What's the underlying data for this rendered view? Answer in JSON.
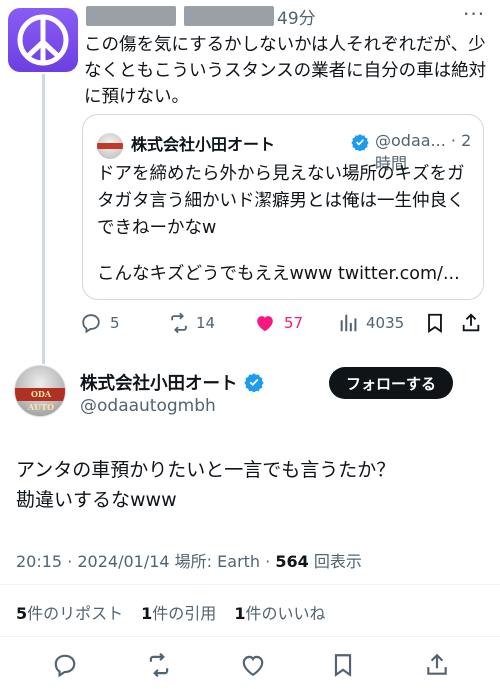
{
  "parent": {
    "time": "49分",
    "more_icon": "more-dots-icon",
    "text": "この傷を気にするかしないかは人それぞれだが、少なくともこういうスタンスの業者に自分の車は絶対に預けない。",
    "quote": {
      "name": "株式会社小田オート",
      "handle_time": "@odaa... · 2時間",
      "text": "ドアを締めたら外から見えない場所のキズをガタガタ言う細かいド潔癖男とは俺は一生仲良くできねーかなw",
      "link_text": "こんなキズどうでもええwww twitter.com/..."
    },
    "actions": {
      "replies": "5",
      "retweets": "14",
      "likes": "57",
      "views": "4035"
    }
  },
  "tweet": {
    "avatar_logo": "ODA AUTO",
    "name": "株式会社小田オート",
    "handle": "@odaautogmbh",
    "follow_label": "フォローする",
    "text_line1": "アンタの車預かりたいと一言でも言うたか？",
    "text_line2": "勘違いするなwww",
    "meta_prefix": "20:15 · 2024/01/14 場所: Earth · ",
    "views": "564",
    "views_suffix": " 回表示",
    "stats": {
      "reposts_count": "5",
      "reposts_label": "件のリポスト",
      "quotes_count": "1",
      "quotes_label": "件の引用",
      "likes_count": "1",
      "likes_label": "件のいいね"
    }
  },
  "colors": {
    "text": "#0f1419",
    "muted": "#536471",
    "like": "#f91880",
    "verified": "#1d9bf0",
    "avatar_purple": "#7c4dff"
  }
}
